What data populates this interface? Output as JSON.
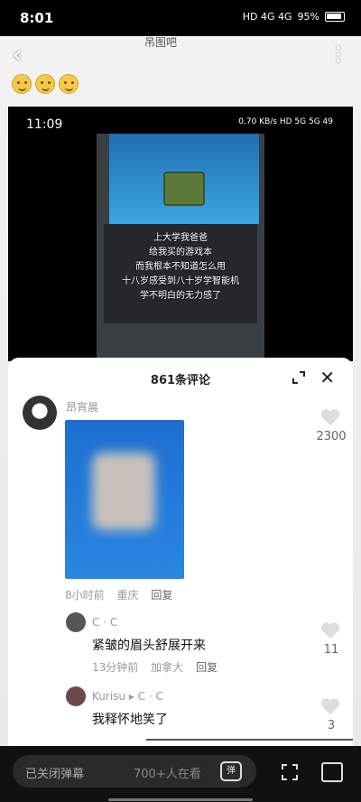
{
  "status": {
    "time": "8:01",
    "battery": "95%",
    "network": "HD 4G 4G"
  },
  "header": {
    "forum": "吊图吧",
    "emojis": [
      "smile",
      "smile",
      "smile"
    ]
  },
  "inner_video": {
    "status_time": "11:09",
    "status_icons": "0.70 KB/s HD 5G 5G 49",
    "caption_lines": [
      "上大学我爸爸",
      "给我买的游戏本",
      "而我根本不知道怎么用",
      "十八岁感受到八十岁学智能机",
      "学不明白的无力感了"
    ]
  },
  "comments": {
    "count_title": "861条评论",
    "main": {
      "user": "昂宵晨",
      "likes": "2300",
      "time": "8小时前",
      "location": "重庆",
      "reply": "回复"
    },
    "replies": [
      {
        "user": "C · C",
        "text": "紧皱的眉头舒展开来",
        "time": "13分钟前",
        "location": "加拿大",
        "reply": "回复",
        "likes": "11"
      },
      {
        "user": "Kurisu",
        "reply_to": "C · C",
        "text": "我释怀地笑了",
        "likes": "3"
      }
    ]
  },
  "bottom": {
    "danmu_placeholder": "已关闭弹幕",
    "viewers": "700+人在看",
    "danmu_icon_text": "弹"
  },
  "progress": 0.4
}
